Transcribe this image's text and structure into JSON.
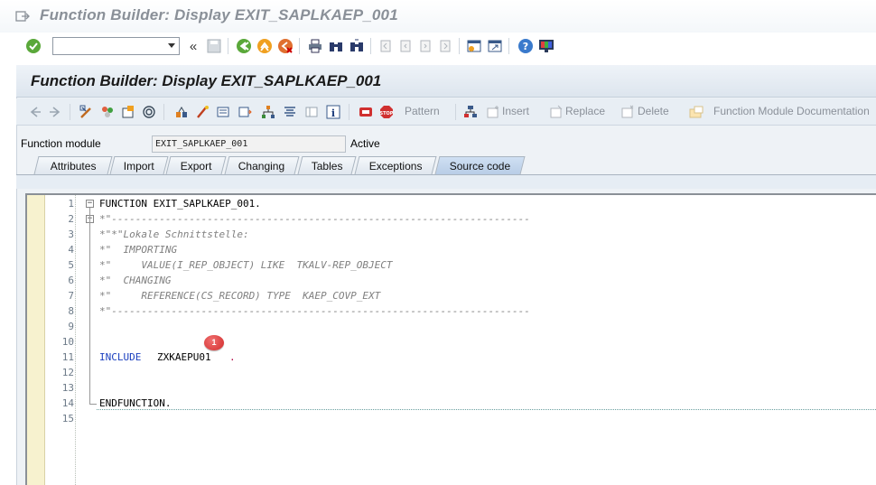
{
  "window": {
    "title": "Function Builder: Display EXIT_SAPLKAEP_001"
  },
  "system_toolbar": {
    "command_field_value": "",
    "icons": [
      "enter-icon",
      "collapse-icon",
      "save-icon",
      "back-icon",
      "exit-icon",
      "cancel-icon",
      "print-icon",
      "find-icon",
      "find-next-icon",
      "first-page-icon",
      "previous-page-icon",
      "next-page-icon",
      "last-page-icon",
      "new-session-icon",
      "shortcut-icon",
      "help-icon",
      "customize-layout-icon"
    ]
  },
  "app": {
    "title": "Function Builder: Display EXIT_SAPLKAEP_001",
    "toolbar": {
      "pattern_label": "Pattern",
      "insert_label": "Insert",
      "replace_label": "Replace",
      "delete_label": "Delete",
      "documentation_label": "Function Module Documentation"
    },
    "function_module_label": "Function module",
    "function_module_value": "EXIT_SAPLKAEP_001",
    "status": "Active",
    "tabs": [
      {
        "label": "Attributes"
      },
      {
        "label": "Import"
      },
      {
        "label": "Export"
      },
      {
        "label": "Changing"
      },
      {
        "label": "Tables"
      },
      {
        "label": "Exceptions"
      },
      {
        "label": "Source code"
      }
    ],
    "active_tab": "Source code"
  },
  "editor": {
    "line_numbers": [
      "1",
      "2",
      "3",
      "4",
      "5",
      "6",
      "7",
      "8",
      "9",
      "10",
      "11",
      "12",
      "13",
      "14",
      "15"
    ],
    "lines": [
      "FUNCTION EXIT_SAPLKAEP_001.",
      "*\"----------------------------------------------------------------------",
      "*\"*\"Lokale Schnittstelle:",
      "*\"  IMPORTING",
      "*\"     VALUE(I_REP_OBJECT) LIKE  TKALV-REP_OBJECT",
      "*\"  CHANGING",
      "*\"     REFERENCE(CS_RECORD) TYPE  KAEP_COVP_EXT",
      "*\"----------------------------------------------------------------------",
      "",
      "",
      "INCLUDE",
      "",
      "",
      "ENDFUNCTION.",
      ""
    ],
    "include_name": "ZXKAEPU01",
    "include_period": ".",
    "endfunction_period": ".",
    "badge": "1"
  }
}
